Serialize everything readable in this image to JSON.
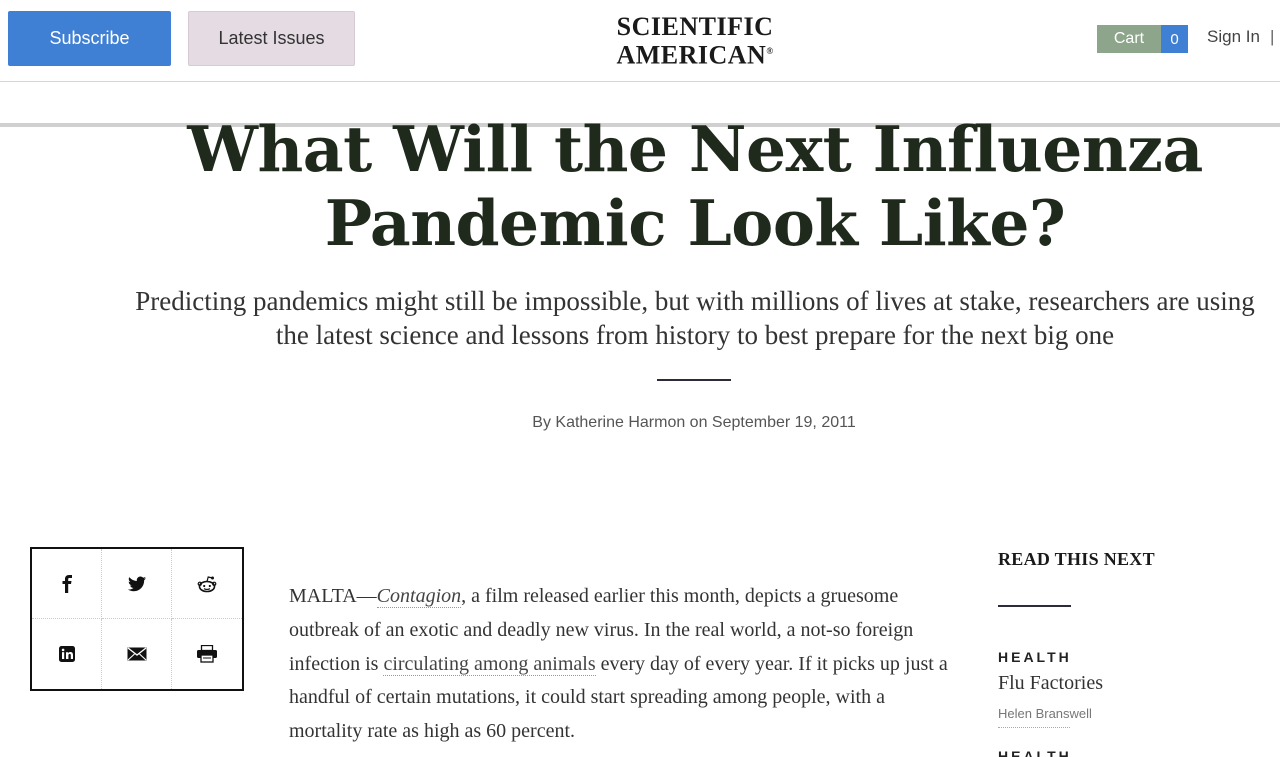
{
  "header": {
    "subscribe_label": "Subscribe",
    "latest_issues_label": "Latest Issues",
    "logo_line1": "SCIENTIFIC",
    "logo_line2": "AMERICAN",
    "logo_reg": "®",
    "cart_label": "Cart",
    "cart_count": "0",
    "sign_in_label": "Sign In",
    "separator": "|"
  },
  "article": {
    "headline_line1": "What Will the Next Influenza",
    "headline_line2": "Pandemic Look Like?",
    "dek": "Predicting pandemics might still be impossible, but with millions of lives at stake, researchers are using the latest science and lessons from history to best prepare for the next big one",
    "byline_prefix": "By ",
    "author": "Katherine Harmon",
    "byline_on": " on ",
    "date": "September 19, 2011",
    "body": {
      "part1": "MALTA—",
      "film_link": "Contagion",
      "part2": ", a film released earlier this month, depicts a gruesome outbreak of an exotic and deadly new virus. In the real world, a not-so foreign infection is ",
      "animals_link": "circulating among animals",
      "part3": " every day of every year. If it picks up just a handful of certain mutations, it could start spreading among people, with a mortality rate as high as 60 percent."
    }
  },
  "share": {
    "icons": [
      "facebook-icon",
      "twitter-icon",
      "reddit-icon",
      "linkedin-icon",
      "email-icon",
      "print-icon"
    ]
  },
  "sidebar": {
    "heading": "READ THIS NEXT",
    "items": [
      {
        "category": "HEALTH",
        "title": "Flu Factories",
        "author": "Helen Branswell"
      },
      {
        "category": "HEALTH"
      }
    ]
  },
  "colors": {
    "subscribe_bg": "#3f7fd4",
    "latest_bg": "#e4dbe3",
    "cart_bg": "#8da58b",
    "cart_count_bg": "#3f7fd4",
    "headline": "#1f2a1d"
  }
}
